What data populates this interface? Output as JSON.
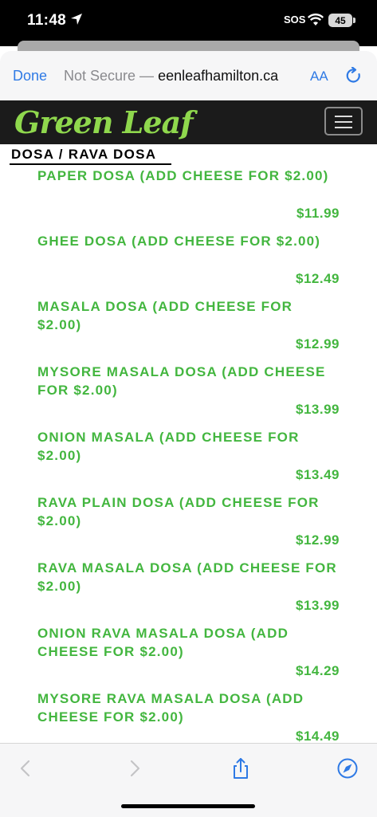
{
  "status_bar": {
    "time": "11:48",
    "sos": "SOS",
    "battery": "45"
  },
  "browser": {
    "done_label": "Done",
    "not_secure": "Not Secure —",
    "host": "eenleafhamilton.ca",
    "text_size": "AA"
  },
  "site": {
    "logo": "Green Leaf"
  },
  "section": {
    "title": "DOSA / RAVA DOSA"
  },
  "items": [
    {
      "name": "PAPER DOSA (ADD CHEESE FOR $2.00)",
      "price": "$11.99"
    },
    {
      "name": "GHEE DOSA (ADD CHEESE FOR $2.00)",
      "price": "$12.49"
    },
    {
      "name": "MASALA DOSA (ADD CHEESE FOR $2.00)",
      "price": "$12.99"
    },
    {
      "name": "MYSORE MASALA DOSA (ADD CHEESE FOR $2.00)",
      "price": "$13.99"
    },
    {
      "name": "ONION MASALA (ADD CHEESE FOR $2.00)",
      "price": "$13.49"
    },
    {
      "name": "RAVA PLAIN DOSA (ADD CHEESE FOR $2.00)",
      "price": "$12.99"
    },
    {
      "name": "RAVA MASALA DOSA (ADD CHEESE FOR $2.00)",
      "price": "$13.99"
    },
    {
      "name": "ONION RAVA MASALA DOSA (ADD CHEESE FOR $2.00)",
      "price": "$14.29"
    },
    {
      "name": "MYSORE RAVA MASALA DOSA (ADD CHEESE FOR $2.00)",
      "price": "$14.49"
    }
  ],
  "bottom_toolbar": {
    "icons": [
      "back-icon",
      "forward-icon",
      "share-icon",
      "compass-icon"
    ]
  },
  "colors": {
    "accent": "#2f7ae5",
    "item_green": "#43b63f",
    "logo_green": "#8fd84d",
    "header_bg": "#1b1b1b"
  }
}
